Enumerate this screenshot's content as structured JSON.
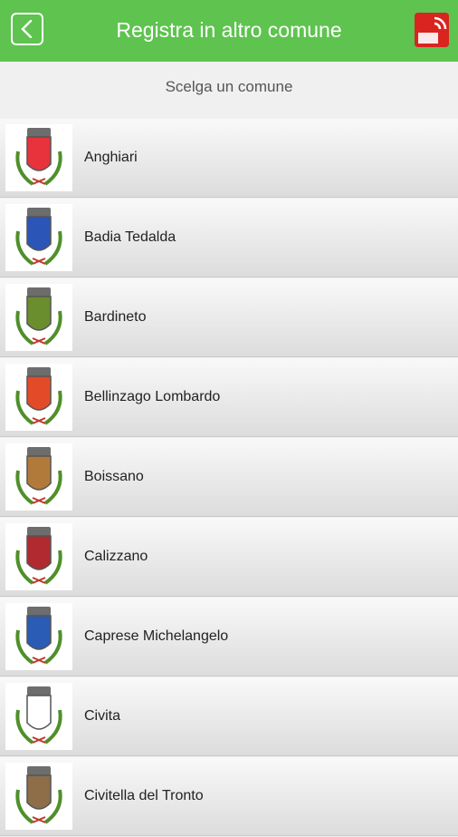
{
  "header": {
    "title": "Registra in altro comune",
    "back_icon": "chevron-left-icon",
    "logo_icon": "comuni-card-logo-icon",
    "background": "#5ec34f"
  },
  "subtitle": "Scelga un comune",
  "comuni": [
    {
      "name": "Anghiari",
      "crest_color": "#e8323c"
    },
    {
      "name": "Badia Tedalda",
      "crest_color": "#2b56b7"
    },
    {
      "name": "Bardineto",
      "crest_color": "#6a8e2e"
    },
    {
      "name": "Bellinzago Lombardo",
      "crest_color": "#e34b28"
    },
    {
      "name": "Boissano",
      "crest_color": "#b27a3a"
    },
    {
      "name": "Calizzano",
      "crest_color": "#b02a2f"
    },
    {
      "name": "Caprese Michelangelo",
      "crest_color": "#2a5bb5"
    },
    {
      "name": "Civita",
      "crest_color": "#ffffff"
    },
    {
      "name": "Civitella del Tronto",
      "crest_color": "#8d6e49"
    }
  ]
}
